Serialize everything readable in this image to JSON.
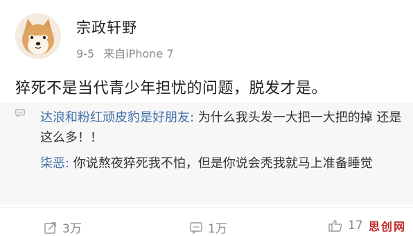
{
  "post": {
    "author": "宗政轩野",
    "time": "9-5",
    "source": "来自iPhone 7",
    "text": "猝死不是当代青少年担忧的问题，脱发才是。"
  },
  "comments": [
    {
      "user": "达浪和粉红顽皮豹是好朋友",
      "separator": ": ",
      "text": "为什么我头发一大把一大把的掉 还是这么多！！"
    },
    {
      "user": "柒恶",
      "separator": ": ",
      "text": "你说熬夜猝死我不怕，但是你说会秃我就马上准备睡觉"
    }
  ],
  "actions": {
    "repost_count": "3万",
    "comment_count": "1万",
    "like_count": "17"
  },
  "watermark": "思创网",
  "icons": {
    "comment_marker": "comment-bubble-icon",
    "repost": "repost-icon",
    "comment": "comment-icon",
    "like": "thumbs-up-icon"
  },
  "colors": {
    "link_blue": "#3f6fa8",
    "meta_gray": "#8a8a8a",
    "comment_bg": "#f7f7f7",
    "watermark_red": "#c02a2a"
  }
}
